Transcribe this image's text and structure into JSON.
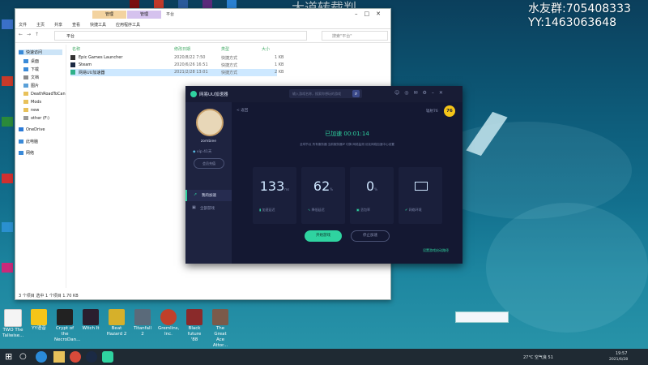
{
  "overlay": {
    "title_banner": "大道转载判",
    "qq_group": "水友群:705408333",
    "yy_channel": "YY:1463063648"
  },
  "explorer": {
    "ribbon_tabs": [
      "文件",
      "主页",
      "共享",
      "查看"
    ],
    "context_manage_1": "管理",
    "context_manage_2": "管理",
    "context_sub_1": "快捷工具",
    "context_sub_2": "应用程序工具",
    "window_title": "平台",
    "address_path": "平台",
    "search_placeholder": "搜索\"平台\"",
    "columns": {
      "name": "名称",
      "modified": "修改日期",
      "type": "类型",
      "size": "大小"
    },
    "files": [
      {
        "name": "Epic Games Launcher",
        "modified": "2020/8/22 7:50",
        "type": "快捷方式",
        "size": "1 KB"
      },
      {
        "name": "Steam",
        "modified": "2020/6/26 16:51",
        "type": "快捷方式",
        "size": "1 KB"
      },
      {
        "name": "网易UU加速器",
        "modified": "2021/2/28 13:01",
        "type": "快捷方式",
        "size": "2 KB"
      }
    ],
    "nav": [
      {
        "label": "快速访问"
      },
      {
        "label": "桌面"
      },
      {
        "label": "下载"
      },
      {
        "label": "文档"
      },
      {
        "label": "图片"
      },
      {
        "label": "DeathRoadToCan"
      },
      {
        "label": "Mods"
      },
      {
        "label": "new"
      },
      {
        "label": "other (F:)"
      },
      {
        "label": "OneDrive"
      },
      {
        "label": "此电脑"
      },
      {
        "label": "网络"
      }
    ],
    "status": "3 个项目    选中 1 个项目  1.70 KB"
  },
  "app": {
    "app_name": "网易UU加速器",
    "search_placeholder": "输入游戏名称，搜索你想玩的游戏",
    "username": "zombiee",
    "vip_text": "vip 41天",
    "member_center": "会员充值",
    "nav_my_accel": "我的加速",
    "nav_all_games": "全部游戏",
    "back": "< 返回",
    "game_name": "辐射76",
    "game_badge": "76",
    "accelerated_label": "已加速 00:01:14",
    "route_info": "全球节点  所有服务器  当前服务器IP   切换   网络监测   优化网络加速中心设置",
    "stats": [
      {
        "value": "133",
        "unit": "ms",
        "label": "加速延迟"
      },
      {
        "value": "62",
        "unit": "%",
        "label": "降低延迟"
      },
      {
        "value": "0",
        "unit": "%",
        "label": "丢包率"
      },
      {
        "value": "",
        "unit": "",
        "label": "网络环境"
      }
    ],
    "start_game": "开始游戏",
    "stop_accel": "停止加速",
    "feedback_link": "设置游戏启动路径"
  },
  "desktop_icons": [
    {
      "label": "TWO The Tallwise..."
    },
    {
      "label": "YY语音"
    },
    {
      "label": "Crypt of the NecroDan..."
    },
    {
      "label": "Witch It"
    },
    {
      "label": "Beat Hazard 2"
    },
    {
      "label": "Titanfall 2"
    },
    {
      "label": "Gremlins, Inc."
    },
    {
      "label": "Black future '88"
    },
    {
      "label": "The Great Ace Attor..."
    }
  ],
  "taskbar": {
    "weather": "27°C 空气良 51",
    "time": "19:57",
    "date": "2021/6/28"
  },
  "colors": {
    "accent": "#2fd3a0",
    "app_bg": "#1b1f3a",
    "taskbar": "#1f2a33"
  }
}
